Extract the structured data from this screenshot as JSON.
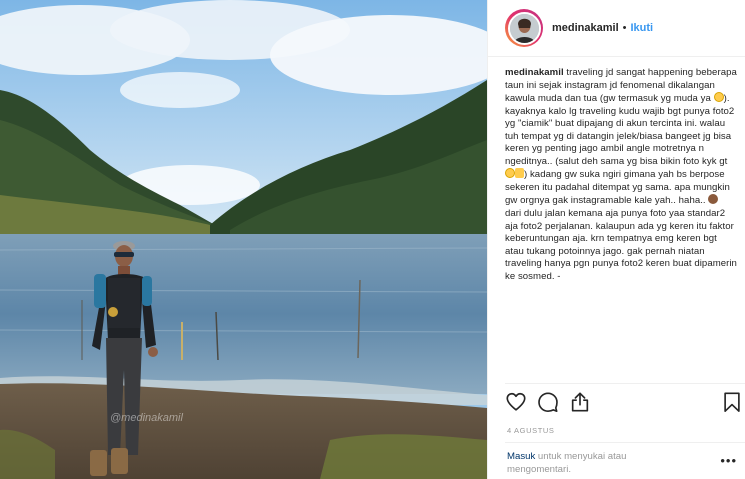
{
  "post": {
    "username": "medinakamil",
    "follow_label": "Ikuti",
    "separator": "•",
    "watermark": "@medinakamil",
    "caption_username": "medinakamil",
    "caption_parts": [
      "traveling jd sangat happening beberapa taun ini sejak instagram jd fenomenal dikalangan kawula muda dan tua (gw termasuk yg muda ya ",
      "). kayaknya kalo lg traveling kudu wajib bgt punya foto2 yg \"ciamik\" buat dipajang di akun tercinta ini. walau tuh tempat yg di datangin jelek/biasa bangeet jg bisa keren yg penting jago ambil angle motretnya n ngeditnya.. (salut deh sama yg bisa bikin foto kyk gt ",
      ") kadang gw suka ngiri gimana yah bs berpose sekeren itu padahal ditempat yg sama. apa mungkin gw orgnya gak instagramable kale yah.. haha.. ",
      " dari dulu jalan kemana aja punya foto yaa standar2 aja foto2 perjalanan. kalaupun ada yg keren itu faktor keberuntungan aja. krn tempatnya emg keren bgt atau tukang potoinnya jago. gak pernah niatan traveling hanya pgn punya foto2 keren buat dipamerin ke sosmed. -"
    ],
    "date": "4 AGUSTUS",
    "login_link": "Masuk",
    "login_rest": " untuk menyukai atau mengomentari.",
    "more_label": "•••"
  },
  "icons": {
    "like": "heart-icon",
    "comment": "comment-icon",
    "share": "share-icon",
    "save": "bookmark-icon"
  },
  "colors": {
    "accent": "#3897f0",
    "link": "#003569",
    "muted": "#999999",
    "text": "#262626"
  }
}
